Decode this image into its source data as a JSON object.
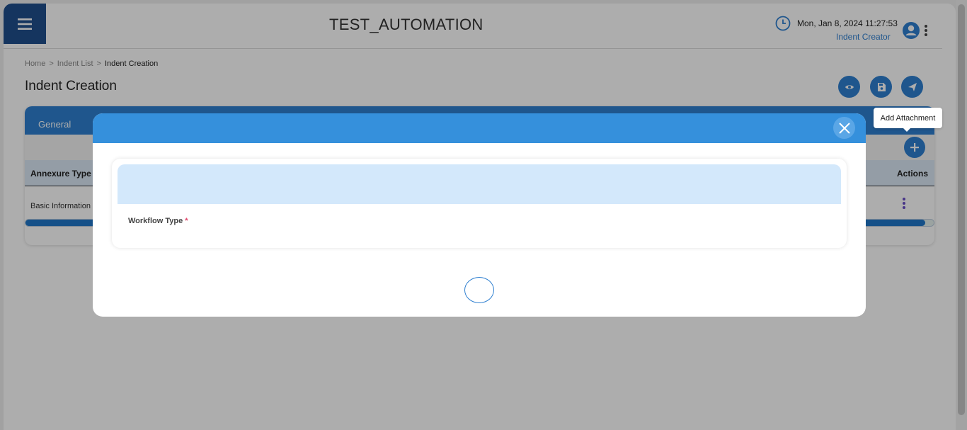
{
  "header": {
    "app_title": "TEST_AUTOMATION",
    "datetime": "Mon, Jan 8, 2024 11:27:53",
    "role": "Indent Creator",
    "menu_icon": "hamburger-icon",
    "clock_icon": "clock-icon",
    "user_icon": "user-circle-icon",
    "more_icon": "vertical-dots-icon"
  },
  "breadcrumb": {
    "items": [
      "Home",
      "Indent List",
      "Indent Creation"
    ],
    "separator": ">"
  },
  "page": {
    "title": "Indent Creation",
    "actions": [
      {
        "name": "preview",
        "icon": "eye-icon"
      },
      {
        "name": "save",
        "icon": "save-icon"
      },
      {
        "name": "submit",
        "icon": "send-icon"
      }
    ]
  },
  "card": {
    "tab_label": "General",
    "add_icon": "plus-icon",
    "tooltip": "Add Attachment",
    "columns": [
      "Annexure Type",
      "Actions"
    ],
    "rows": [
      [
        "Basic Information"
      ]
    ]
  },
  "modal": {
    "close_icon": "close-icon",
    "field_label": "Workflow Type",
    "required_marker": "*"
  },
  "colors": {
    "primary": "#2e7fd0",
    "nav_dark": "#1f4e8c",
    "modal_header": "#3590dc",
    "form_band": "#d3e8fb",
    "required": "#e0456a"
  }
}
